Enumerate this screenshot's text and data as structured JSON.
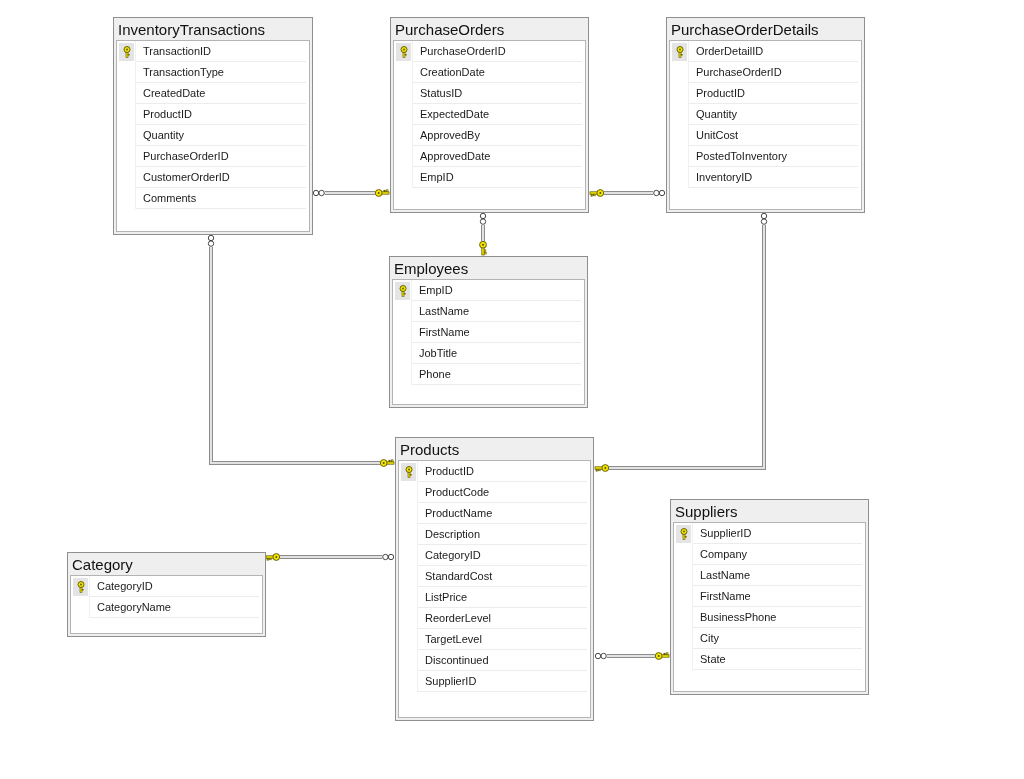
{
  "tables": [
    {
      "title": "InventoryTransactions",
      "columns": [
        {
          "name": "TransactionID",
          "primary_key": true
        },
        {
          "name": "TransactionType",
          "primary_key": false
        },
        {
          "name": "CreatedDate",
          "primary_key": false
        },
        {
          "name": "ProductID",
          "primary_key": false
        },
        {
          "name": "Quantity",
          "primary_key": false
        },
        {
          "name": "PurchaseOrderID",
          "primary_key": false
        },
        {
          "name": "CustomerOrderID",
          "primary_key": false
        },
        {
          "name": "Comments",
          "primary_key": false
        }
      ]
    },
    {
      "title": "PurchaseOrders",
      "columns": [
        {
          "name": "PurchaseOrderID",
          "primary_key": true
        },
        {
          "name": "CreationDate",
          "primary_key": false
        },
        {
          "name": "StatusID",
          "primary_key": false
        },
        {
          "name": "ExpectedDate",
          "primary_key": false
        },
        {
          "name": "ApprovedBy",
          "primary_key": false
        },
        {
          "name": "ApprovedDate",
          "primary_key": false
        },
        {
          "name": "EmpID",
          "primary_key": false
        }
      ]
    },
    {
      "title": "PurchaseOrderDetails",
      "columns": [
        {
          "name": "OrderDetailID",
          "primary_key": true
        },
        {
          "name": "PurchaseOrderID",
          "primary_key": false
        },
        {
          "name": "ProductID",
          "primary_key": false
        },
        {
          "name": "Quantity",
          "primary_key": false
        },
        {
          "name": "UnitCost",
          "primary_key": false
        },
        {
          "name": "PostedToInventory",
          "primary_key": false
        },
        {
          "name": "InventoryID",
          "primary_key": false
        }
      ]
    },
    {
      "title": "Employees",
      "columns": [
        {
          "name": "EmpID",
          "primary_key": true
        },
        {
          "name": "LastName",
          "primary_key": false
        },
        {
          "name": "FirstName",
          "primary_key": false
        },
        {
          "name": "JobTitle",
          "primary_key": false
        },
        {
          "name": "Phone",
          "primary_key": false
        }
      ]
    },
    {
      "title": "Products",
      "columns": [
        {
          "name": "ProductID",
          "primary_key": true
        },
        {
          "name": "ProductCode",
          "primary_key": false
        },
        {
          "name": "ProductName",
          "primary_key": false
        },
        {
          "name": "Description",
          "primary_key": false
        },
        {
          "name": "CategoryID",
          "primary_key": false
        },
        {
          "name": "StandardCost",
          "primary_key": false
        },
        {
          "name": "ListPrice",
          "primary_key": false
        },
        {
          "name": "ReorderLevel",
          "primary_key": false
        },
        {
          "name": "TargetLevel",
          "primary_key": false
        },
        {
          "name": "Discontinued",
          "primary_key": false
        },
        {
          "name": "SupplierID",
          "primary_key": false
        }
      ]
    },
    {
      "title": "Category",
      "columns": [
        {
          "name": "CategoryID",
          "primary_key": true
        },
        {
          "name": "CategoryName",
          "primary_key": false
        }
      ]
    },
    {
      "title": "Suppliers",
      "columns": [
        {
          "name": "SupplierID",
          "primary_key": true
        },
        {
          "name": "Company",
          "primary_key": false
        },
        {
          "name": "LastName",
          "primary_key": false
        },
        {
          "name": "FirstName",
          "primary_key": false
        },
        {
          "name": "BusinessPhone",
          "primary_key": false
        },
        {
          "name": "City",
          "primary_key": false
        },
        {
          "name": "State",
          "primary_key": false
        }
      ]
    }
  ],
  "relationships": [
    {
      "ends": [
        {
          "kind": "many"
        },
        {
          "kind": "one"
        }
      ]
    },
    {
      "ends": [
        {
          "kind": "one"
        },
        {
          "kind": "many"
        }
      ]
    },
    {
      "ends": [
        {
          "kind": "many"
        },
        {
          "kind": "one"
        }
      ]
    },
    {
      "ends": [
        {
          "kind": "many"
        },
        {
          "kind": "one"
        }
      ]
    },
    {
      "ends": [
        {
          "kind": "many"
        },
        {
          "kind": "one"
        }
      ]
    },
    {
      "ends": [
        {
          "kind": "one"
        },
        {
          "kind": "many"
        }
      ]
    },
    {
      "ends": [
        {
          "kind": "many"
        },
        {
          "kind": "one"
        }
      ]
    }
  ]
}
